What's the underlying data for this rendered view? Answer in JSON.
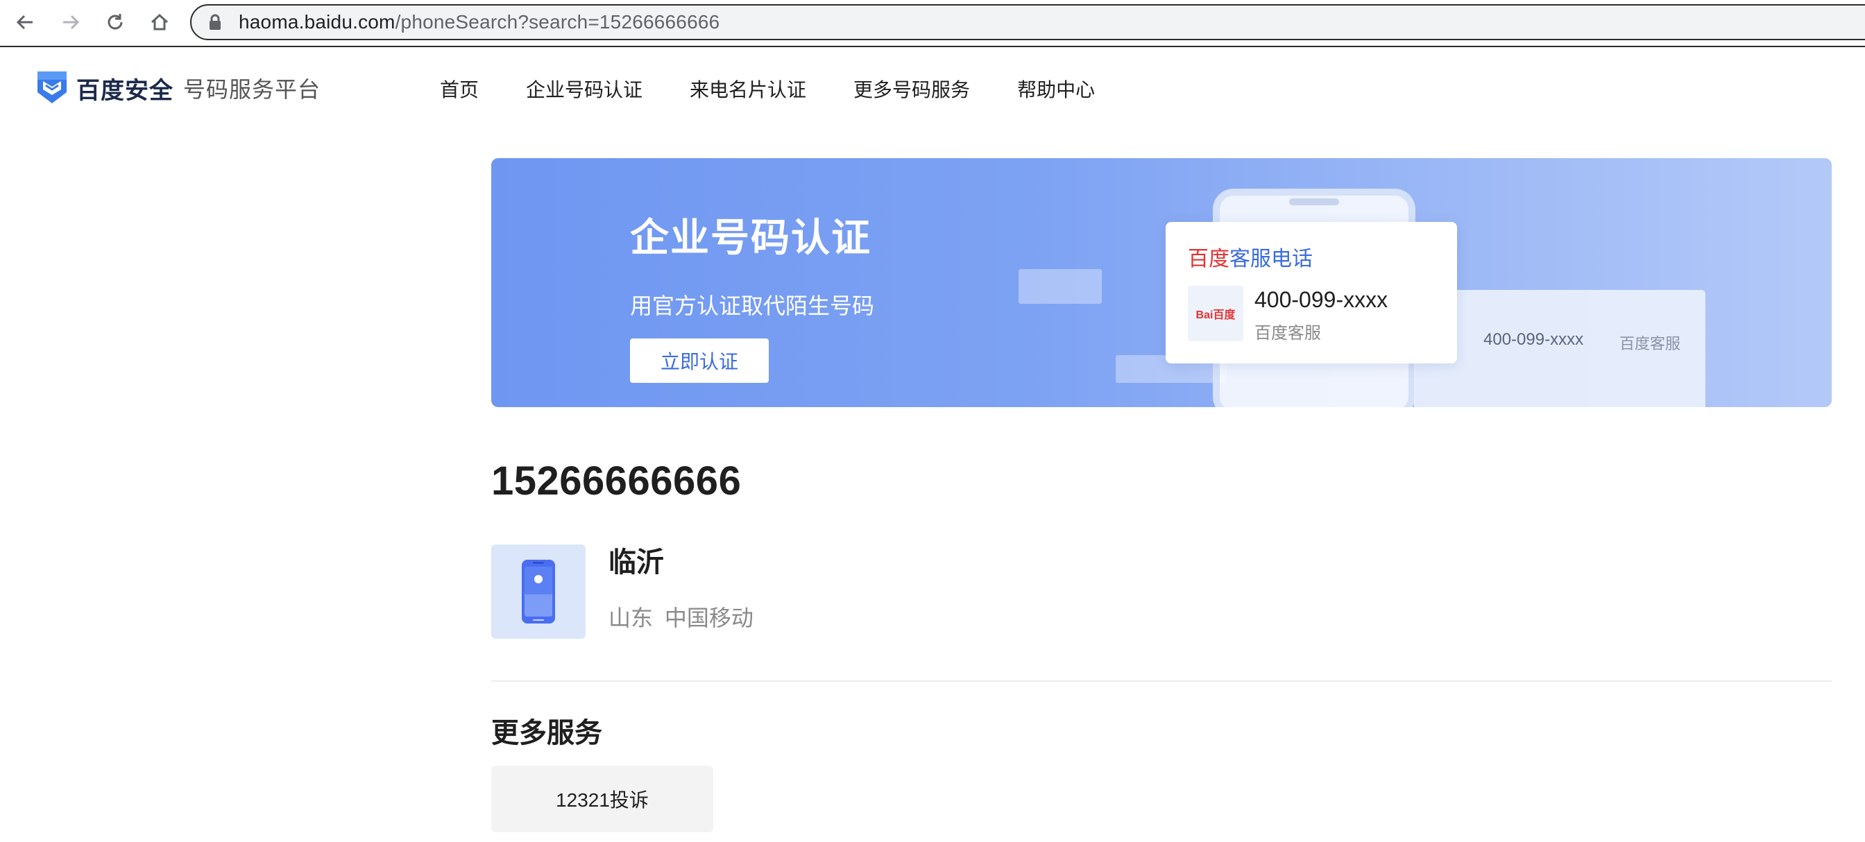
{
  "browser": {
    "url_host": "haoma.baidu.com",
    "url_path": "/phoneSearch?search=15266666666"
  },
  "header": {
    "logo_brand": "百度安全",
    "logo_subtitle": "号码服务平台",
    "nav": [
      "首页",
      "企业号码认证",
      "来电名片认证",
      "更多号码服务",
      "帮助中心"
    ]
  },
  "banner": {
    "title": "企业号码认证",
    "subtitle": "用官方认证取代陌生号码",
    "button_label": "立即认证",
    "card_title_red": "百度",
    "card_title_blue": "客服电话",
    "card_logo_text": "Bai百度",
    "card_number": "400-099-xxxx",
    "card_name": "百度客服",
    "window_number": "400-099-xxxx",
    "window_name": "百度客服"
  },
  "result": {
    "phone_number": "15266666666",
    "city": "临沂",
    "province": "山东",
    "carrier": "中国移动"
  },
  "more_services": {
    "title": "更多服务",
    "items": [
      "12321投诉"
    ]
  },
  "colors": {
    "accent": "#3a6be0",
    "brand_red": "#e53232",
    "banner_start": "#6f97f2",
    "banner_end": "#b3c9f8"
  }
}
